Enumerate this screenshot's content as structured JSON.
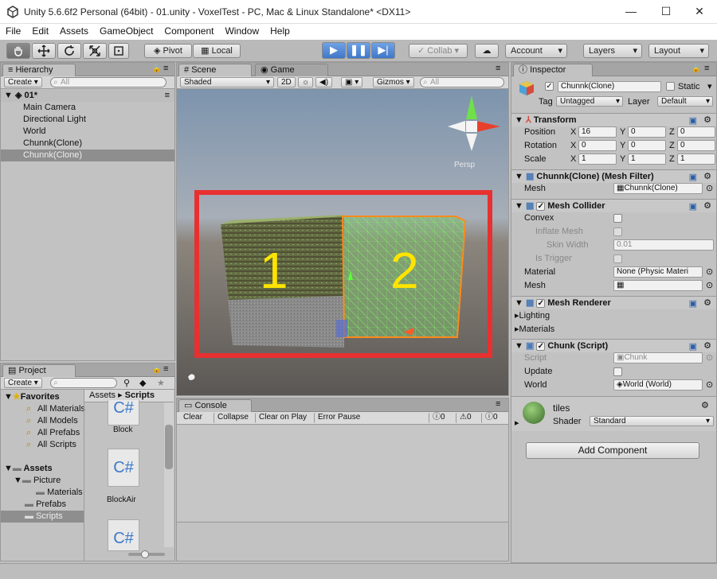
{
  "window": {
    "title": "Unity 5.6.6f2 Personal (64bit) - 01.unity - VoxelTest - PC, Mac & Linux Standalone* <DX11>",
    "min": "—",
    "max": "☐",
    "close": "✕"
  },
  "menu": [
    "File",
    "Edit",
    "Assets",
    "GameObject",
    "Component",
    "Window",
    "Help"
  ],
  "toolbar": {
    "pivot": "Pivot",
    "local": "Local",
    "collab": "Collab",
    "account": "Account",
    "layers": "Layers",
    "layout": "Layout"
  },
  "hierarchy": {
    "tab": "Hierarchy",
    "create": "Create",
    "search": "All",
    "scene": "01*",
    "items": [
      "Main Camera",
      "Directional Light",
      "World",
      "Chunnk(Clone)",
      "Chunnk(Clone)"
    ]
  },
  "scene": {
    "tab_scene": "Scene",
    "tab_game": "Game",
    "shaded": "Shaded",
    "mode2d": "2D",
    "gizmos": "Gizmos",
    "search": "All",
    "persp": "Persp",
    "annotation_1": "1",
    "annotation_2": "2",
    "annotation_color": "#e83030",
    "highlight_color": "#ffe400"
  },
  "project": {
    "tab": "Project",
    "create": "Create",
    "favorites": "Favorites",
    "fav_items": [
      "All Materials",
      "All Models",
      "All Prefabs",
      "All Scripts"
    ],
    "assets": "Assets",
    "picture": "Picture",
    "materials": "Materials",
    "prefabs": "Prefabs",
    "scripts": "Scripts",
    "crumb_assets": "Assets",
    "crumb_scripts": "Scripts",
    "files": [
      "Block",
      "BlockAir"
    ]
  },
  "console": {
    "tab": "Console",
    "clear": "Clear",
    "collapse": "Collapse",
    "clear_on_play": "Clear on Play",
    "error_pause": "Error Pause",
    "count_info": "0",
    "count_warn": "0",
    "count_err": "0"
  },
  "inspector": {
    "tab": "Inspector",
    "name": "Chunnk(Clone)",
    "static": "Static",
    "tag_label": "Tag",
    "tag": "Untagged",
    "layer_label": "Layer",
    "layer": "Default",
    "transform": {
      "title": "Transform",
      "position": "Position",
      "rotation": "Rotation",
      "scale": "Scale",
      "pos": [
        "16",
        "0",
        "0"
      ],
      "rot": [
        "0",
        "0",
        "0"
      ],
      "scl": [
        "1",
        "1",
        "1"
      ]
    },
    "mesh_filter": {
      "title": "Chunnk(Clone) (Mesh Filter)",
      "mesh_label": "Mesh",
      "mesh": "Chunnk(Clone)"
    },
    "mesh_collider": {
      "title": "Mesh Collider",
      "convex": "Convex",
      "inflate": "Inflate Mesh",
      "skin": "Skin Width",
      "skin_val": "0.01",
      "trigger": "Is Trigger",
      "material_label": "Material",
      "material": "None (Physic Materi",
      "mesh_label": "Mesh"
    },
    "mesh_renderer": {
      "title": "Mesh Renderer",
      "lighting": "Lighting",
      "materials": "Materials"
    },
    "chunk": {
      "title": "Chunk (Script)",
      "script_label": "Script",
      "script": "Chunk",
      "update": "Update",
      "world_label": "World",
      "world": "World (World)"
    },
    "material": {
      "name": "tiles",
      "shader_label": "Shader",
      "shader": "Standard"
    },
    "add_component": "Add Component"
  }
}
